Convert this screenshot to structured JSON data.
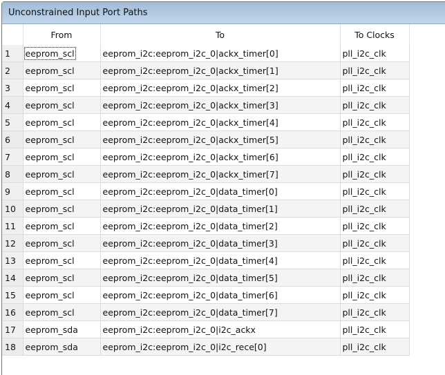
{
  "panel": {
    "title": "Unconstrained Input Port Paths"
  },
  "table": {
    "columns": [
      "",
      "From",
      "To",
      "To Clocks"
    ],
    "rows": [
      [
        "1",
        "eeprom_scl",
        "eeprom_i2c:eeprom_i2c_0|ackx_timer[0]",
        "pll_i2c_clk"
      ],
      [
        "2",
        "eeprom_scl",
        "eeprom_i2c:eeprom_i2c_0|ackx_timer[1]",
        "pll_i2c_clk"
      ],
      [
        "3",
        "eeprom_scl",
        "eeprom_i2c:eeprom_i2c_0|ackx_timer[2]",
        "pll_i2c_clk"
      ],
      [
        "4",
        "eeprom_scl",
        "eeprom_i2c:eeprom_i2c_0|ackx_timer[3]",
        "pll_i2c_clk"
      ],
      [
        "5",
        "eeprom_scl",
        "eeprom_i2c:eeprom_i2c_0|ackx_timer[4]",
        "pll_i2c_clk"
      ],
      [
        "6",
        "eeprom_scl",
        "eeprom_i2c:eeprom_i2c_0|ackx_timer[5]",
        "pll_i2c_clk"
      ],
      [
        "7",
        "eeprom_scl",
        "eeprom_i2c:eeprom_i2c_0|ackx_timer[6]",
        "pll_i2c_clk"
      ],
      [
        "8",
        "eeprom_scl",
        "eeprom_i2c:eeprom_i2c_0|ackx_timer[7]",
        "pll_i2c_clk"
      ],
      [
        "9",
        "eeprom_scl",
        "eeprom_i2c:eeprom_i2c_0|data_timer[0]",
        "pll_i2c_clk"
      ],
      [
        "10",
        "eeprom_scl",
        "eeprom_i2c:eeprom_i2c_0|data_timer[1]",
        "pll_i2c_clk"
      ],
      [
        "11",
        "eeprom_scl",
        "eeprom_i2c:eeprom_i2c_0|data_timer[2]",
        "pll_i2c_clk"
      ],
      [
        "12",
        "eeprom_scl",
        "eeprom_i2c:eeprom_i2c_0|data_timer[3]",
        "pll_i2c_clk"
      ],
      [
        "13",
        "eeprom_scl",
        "eeprom_i2c:eeprom_i2c_0|data_timer[4]",
        "pll_i2c_clk"
      ],
      [
        "14",
        "eeprom_scl",
        "eeprom_i2c:eeprom_i2c_0|data_timer[5]",
        "pll_i2c_clk"
      ],
      [
        "15",
        "eeprom_scl",
        "eeprom_i2c:eeprom_i2c_0|data_timer[6]",
        "pll_i2c_clk"
      ],
      [
        "16",
        "eeprom_scl",
        "eeprom_i2c:eeprom_i2c_0|data_timer[7]",
        "pll_i2c_clk"
      ],
      [
        "17",
        "eeprom_sda",
        "eeprom_i2c:eeprom_i2c_0|i2c_ackx",
        "pll_i2c_clk"
      ],
      [
        "18",
        "eeprom_sda",
        "eeprom_i2c:eeprom_i2c_0|i2c_rece[0]",
        "pll_i2c_clk"
      ]
    ]
  }
}
